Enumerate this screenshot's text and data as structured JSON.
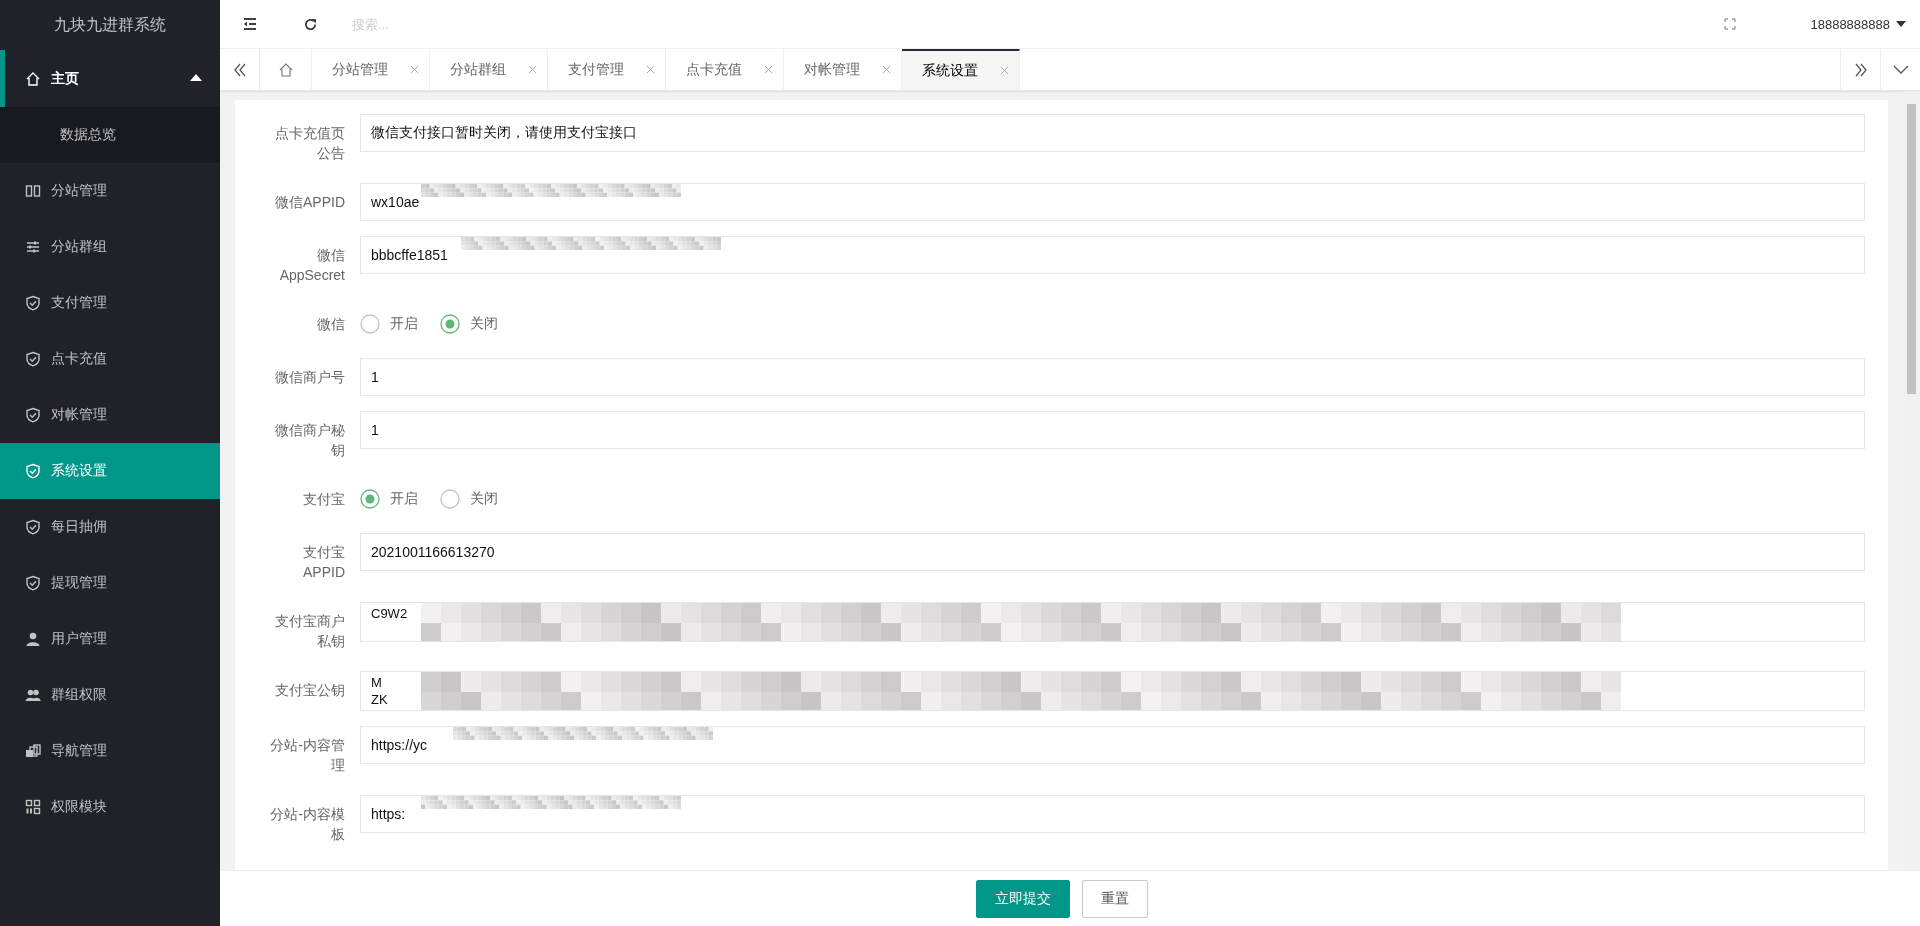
{
  "sidebar": {
    "title": "九块九进群系统",
    "items": [
      {
        "label": "主页",
        "selected": false,
        "expanded": true,
        "children": [
          {
            "label": "数据总览",
            "selected": false
          }
        ]
      },
      {
        "label": "分站管理",
        "selected": false
      },
      {
        "label": "分站群组",
        "selected": false
      },
      {
        "label": "支付管理",
        "selected": false
      },
      {
        "label": "点卡充值",
        "selected": false
      },
      {
        "label": "对帐管理",
        "selected": false
      },
      {
        "label": "系统设置",
        "selected": true
      },
      {
        "label": "每日抽佣",
        "selected": false
      },
      {
        "label": "提现管理",
        "selected": false
      },
      {
        "label": "用户管理",
        "selected": false
      },
      {
        "label": "群组权限",
        "selected": false
      },
      {
        "label": "导航管理",
        "selected": false
      },
      {
        "label": "权限模块",
        "selected": false
      }
    ]
  },
  "header": {
    "search": {
      "placeholder": "搜索..."
    },
    "user": "18888888888"
  },
  "tabs": [
    {
      "label": "分站管理",
      "selected": false
    },
    {
      "label": "分站群组",
      "selected": false
    },
    {
      "label": "支付管理",
      "selected": false
    },
    {
      "label": "点卡充值",
      "selected": false
    },
    {
      "label": "对帐管理",
      "selected": false
    },
    {
      "label": "系统设置",
      "selected": true
    }
  ],
  "form": {
    "fields": [
      {
        "kind": "input",
        "label": "点卡充值页公告",
        "value": "微信支付接口暂时关闭，请使用支付宝接口",
        "redacted": false
      },
      {
        "kind": "input",
        "label": "微信APPID",
        "value": "wx10ae",
        "redacted": true
      },
      {
        "kind": "input",
        "label": "微信AppSecret",
        "value": "bbbcffe1851",
        "redacted": true
      },
      {
        "kind": "radio",
        "label": "微信",
        "options": [
          {
            "label": "开启",
            "selected": false
          },
          {
            "label": "关闭",
            "selected": true
          }
        ]
      },
      {
        "kind": "input",
        "label": "微信商户号",
        "value": "1",
        "redacted": false
      },
      {
        "kind": "input",
        "label": "微信商户秘钥",
        "value": "1",
        "redacted": false
      },
      {
        "kind": "radio",
        "label": "支付宝",
        "options": [
          {
            "label": "开启",
            "selected": true
          },
          {
            "label": "关闭",
            "selected": false
          }
        ]
      },
      {
        "kind": "input",
        "label": "支付宝APPID",
        "value": "2021001166613270",
        "redacted": false
      },
      {
        "kind": "textarea",
        "label": "支付宝商户私钥",
        "value": "C9W2",
        "redacted": true
      },
      {
        "kind": "textarea",
        "label": "支付宝公钥",
        "value": "M\nZK",
        "redacted": true
      },
      {
        "kind": "input",
        "label": "分站-内容管理",
        "value": "https://yc",
        "redacted": true
      },
      {
        "kind": "input",
        "label": "分站-内容模板",
        "value": "https:",
        "redacted": true
      }
    ],
    "buttons": [
      {
        "label": "立即提交",
        "kind": "primary"
      },
      {
        "label": "重置",
        "kind": "plain"
      }
    ]
  }
}
